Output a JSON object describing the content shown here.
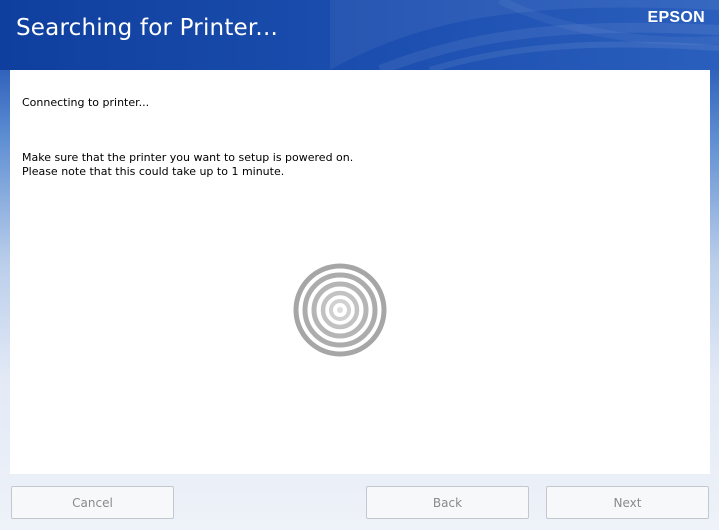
{
  "window": {
    "title": "Searching for Printer...",
    "brand": "EPSON"
  },
  "main": {
    "status": "Connecting to printer...",
    "instructions": [
      "Make sure that the printer you want to setup is powered on.",
      "Please note that this could take up to 1 minute."
    ],
    "spinner_icon": "searching-rings-icon"
  },
  "buttons": {
    "cancel_label": "Cancel",
    "back_label": "Back",
    "next_label": "Next"
  },
  "colors": {
    "header_blue": "#1c4fb0",
    "spinner_gray": "#a6a6a6",
    "disabled_text": "#8a8a8a"
  }
}
